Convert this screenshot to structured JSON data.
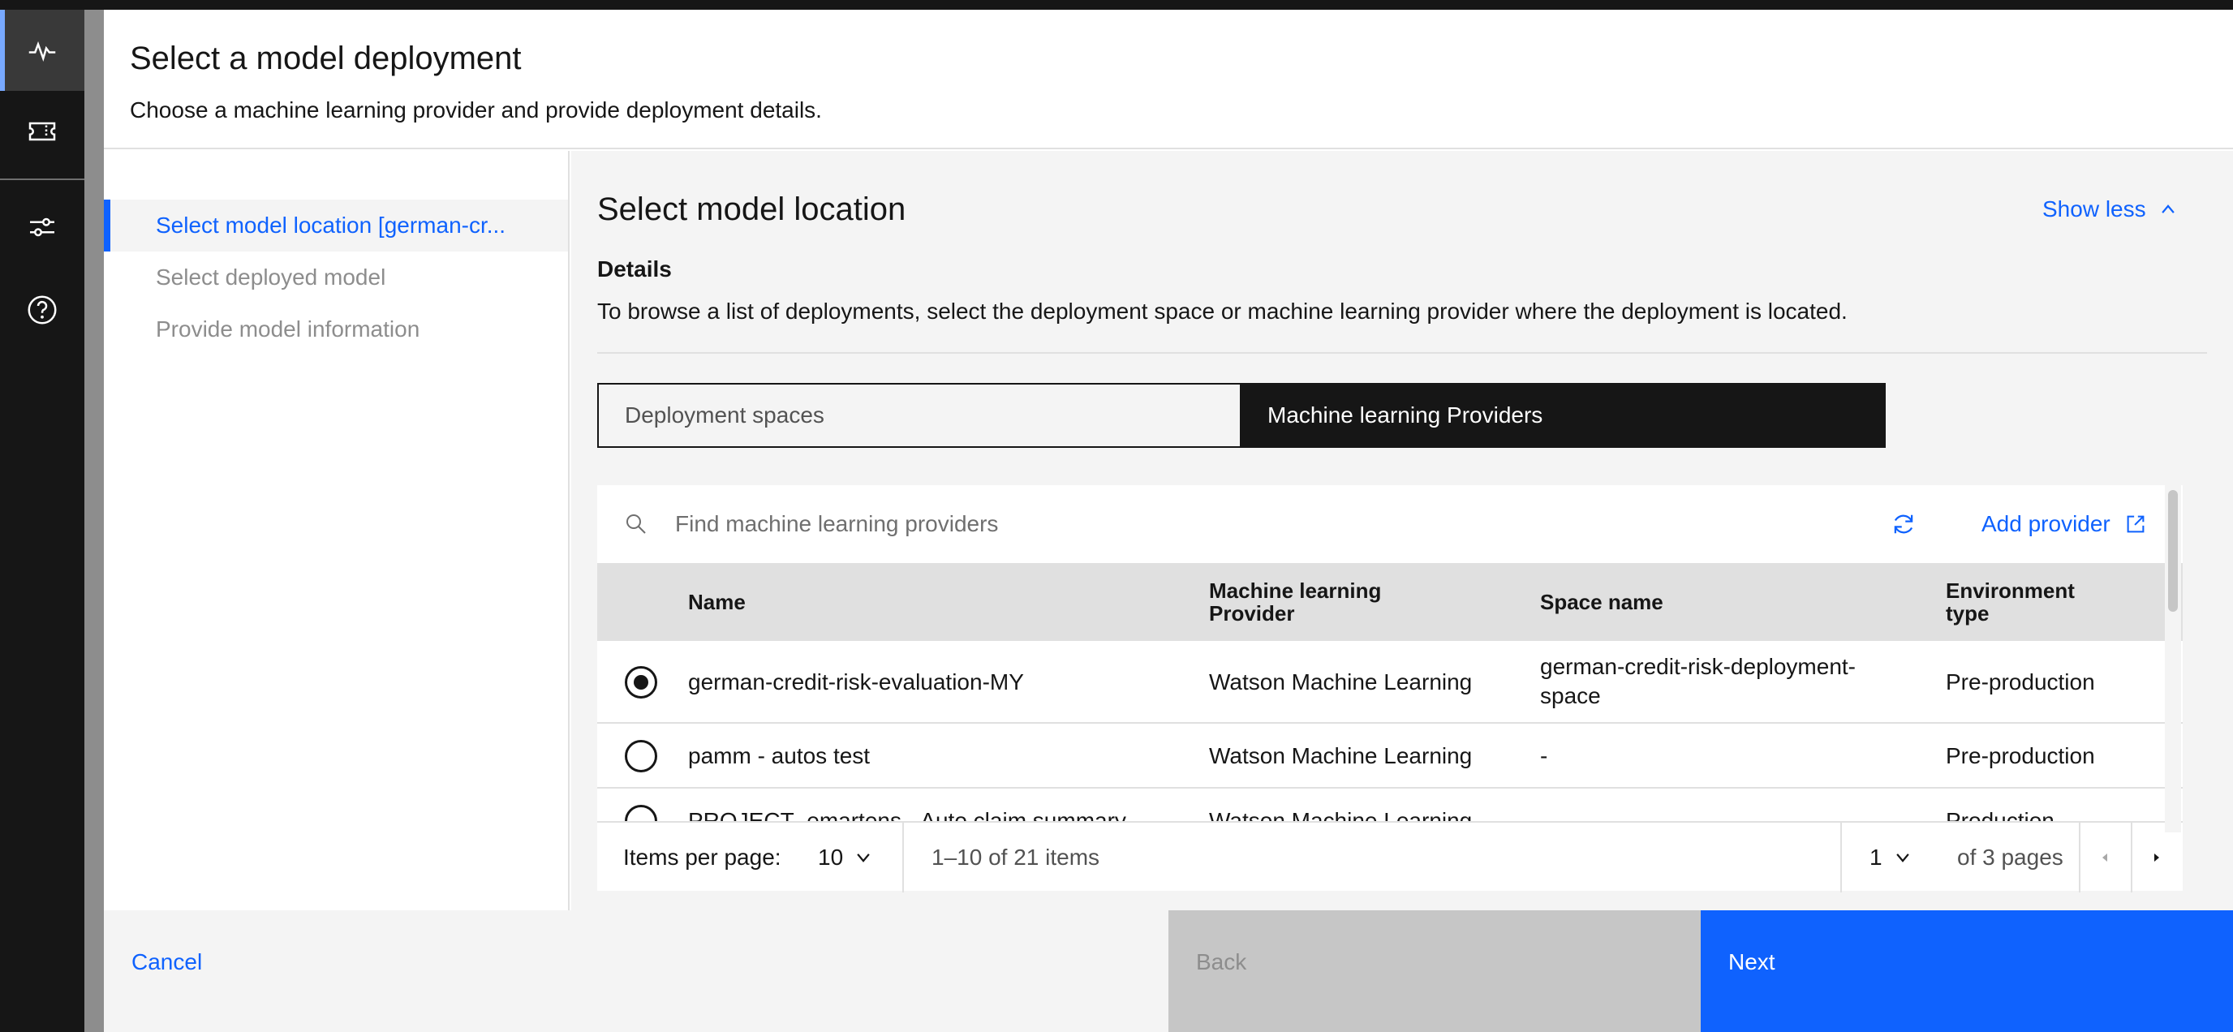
{
  "modal": {
    "title": "Select a model deployment",
    "subtitle": "Choose a machine learning provider and provide deployment details."
  },
  "steps": [
    {
      "label": "Select model location [german-cr..."
    },
    {
      "label": "Select deployed model"
    },
    {
      "label": "Provide model information"
    }
  ],
  "panel": {
    "title": "Select model location",
    "show_less": "Show less",
    "details_heading": "Details",
    "details_text": "To browse a list of deployments, select the deployment space or machine learning provider where the deployment is located."
  },
  "switcher": {
    "option1": "Deployment spaces",
    "option2": "Machine learning Providers",
    "selected": "Machine learning Providers"
  },
  "table": {
    "search_placeholder": "Find machine learning providers",
    "add_provider": "Add provider",
    "headers": {
      "name": "Name",
      "provider_line1": "Machine learning",
      "provider_line2": "Provider",
      "space": "Space name",
      "env_line1": "Environment",
      "env_line2": "type"
    },
    "rows": [
      {
        "name": "german-credit-risk-evaluation-MY",
        "provider": "Watson Machine Learning",
        "space_line1": "german-credit-risk-deployment-",
        "space_line2": "space",
        "env": "Pre-production",
        "selected": true
      },
      {
        "name": "pamm - autos test",
        "provider": "Watson Machine Learning",
        "space_line1": "-",
        "space_line2": "",
        "env": "Pre-production",
        "selected": false
      },
      {
        "name": "PROJECT_emartens - Auto claim summary",
        "provider": "Watson Machine Learning",
        "space_line1": "-",
        "space_line2": "",
        "env": "Production",
        "selected": false
      }
    ]
  },
  "pagination": {
    "items_per_page_label": "Items per page:",
    "items_per_page": "10",
    "range": "1–10 of 21 items",
    "page": "1",
    "of_pages": "of 3 pages"
  },
  "footer": {
    "cancel": "Cancel",
    "back": "Back",
    "next": "Next"
  },
  "icons": {
    "rail": [
      "activity-icon",
      "ticket-icon",
      "sliders-icon",
      "help-icon"
    ]
  },
  "colors": {
    "accent": "#0f62fe",
    "rail": "#161616",
    "rail_active": "#393939"
  }
}
